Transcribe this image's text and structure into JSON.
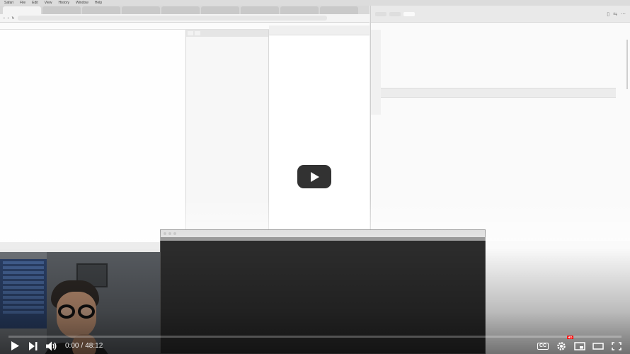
{
  "browser": {
    "menubar": [
      "Safari",
      "File",
      "Edit",
      "View",
      "History",
      "Window",
      "Help"
    ],
    "menubar_right": [
      "",
      "",
      ""
    ],
    "tabs": [
      "",
      "",
      "",
      "",
      "",
      "",
      "",
      "",
      ""
    ],
    "address": "",
    "toolbar_items": [
      "",
      "",
      "",
      "",
      "",
      ""
    ],
    "left_rows": [
      "",
      ""
    ],
    "tree_tabs": [
      "",
      ""
    ],
    "tree_rows": [
      "",
      "",
      "",
      "",
      "",
      "",
      "",
      "",
      "",
      "",
      "",
      "",
      "",
      "",
      "",
      "",
      "",
      "",
      "",
      "",
      "",
      "",
      "",
      "",
      "",
      "",
      "",
      "",
      "",
      "",
      "",
      "",
      "",
      "",
      ""
    ],
    "code_tabs": [
      "",
      ""
    ],
    "code_lines": [
      "",
      "",
      ""
    ]
  },
  "editor": {
    "tabs": [
      "",
      "",
      ""
    ],
    "breadcrumb": "",
    "lines": [
      "",
      "",
      "",
      "",
      "",
      "",
      "",
      "",
      "",
      "",
      ""
    ]
  },
  "terminal": {
    "title": "",
    "lines": [
      "",
      "",
      "",
      "",
      "",
      "",
      "",
      "",
      "",
      "",
      "",
      "",
      "",
      "",
      "",
      "",
      "",
      "",
      "",
      ""
    ]
  },
  "player": {
    "current_time": "0:00",
    "duration": "48:12",
    "progress": 0,
    "icons": [
      "play-icon",
      "next-icon",
      "volume-icon",
      "subtitles-icon",
      "settings-icon",
      "miniplayer-icon",
      "theater-icon",
      "fullscreen-icon"
    ],
    "accent": "#ff0000",
    "quality_badge": "HD"
  }
}
